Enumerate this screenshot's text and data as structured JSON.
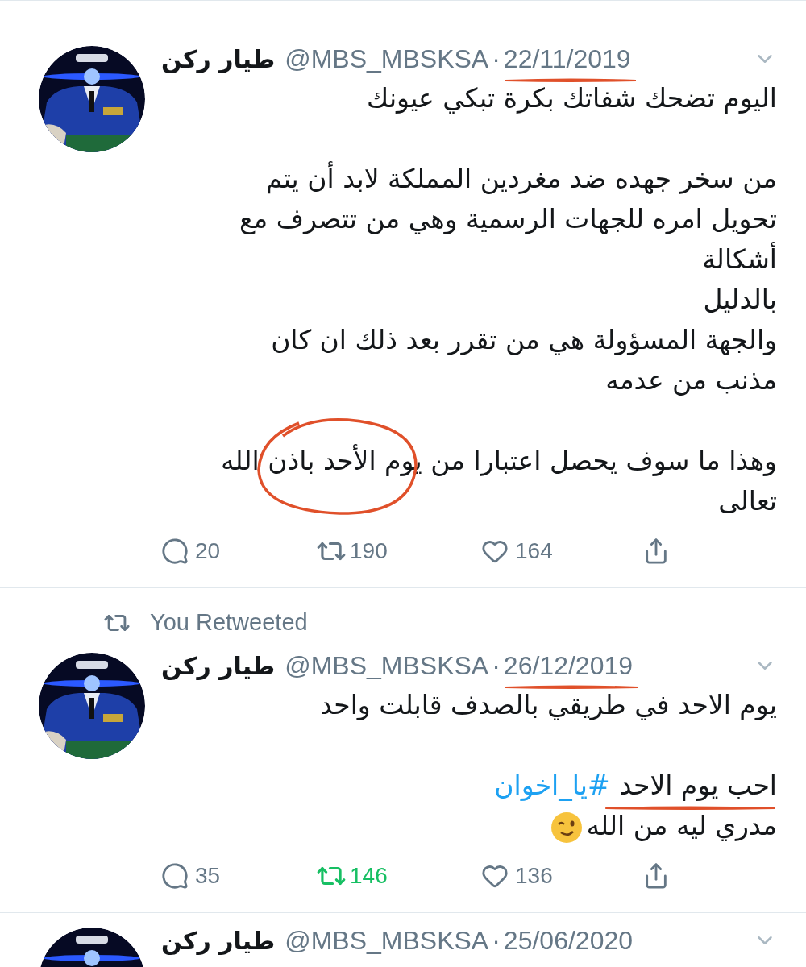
{
  "tweets": [
    {
      "name": "طيار ركن",
      "handle": "@MBS_MBSKSA",
      "dot": "·",
      "date": "22/11/2019",
      "date_marked": true,
      "paragraphs": [
        [
          {
            "text": "اليوم تضحك شفاتك بكرة تبكي عيونك"
          }
        ],
        [
          {
            "text": "من سخر جهده ضد مغردين المملكة لابد أن يتم"
          },
          {
            "text": "تحويل امره للجهات الرسمية وهي من تتصرف مع"
          },
          {
            "text": "أشكالة"
          },
          {
            "text": "بالدليل"
          },
          {
            "text": "والجهة المسؤولة هي من تقرر بعد ذلك ان كان"
          },
          {
            "text": "مذنب من عدمه"
          }
        ],
        [
          {
            "text": "وهذا ما سوف يحصل اعتبارا من يوم الأحد باذن الله",
            "circled": true
          },
          {
            "text": "تعالى"
          }
        ]
      ],
      "replies": "20",
      "retweets": "190",
      "likes": "164",
      "retweeted": false
    },
    {
      "retweet_label": "You Retweeted",
      "name": "طيار ركن",
      "handle": "@MBS_MBSKSA",
      "dot": "·",
      "date": "26/12/2019",
      "date_marked": true,
      "paragraphs": [
        [
          {
            "text": "يوم الاحد في طريقي بالصدف قابلت واحد"
          }
        ],
        [
          {
            "text": "احب يوم الاحد",
            "hashtag": "#يا_اخوان",
            "underlined": true
          },
          {
            "text": "مدري ليه من الله",
            "emoji": true
          }
        ]
      ],
      "replies": "35",
      "retweets": "146",
      "likes": "136",
      "retweeted": true
    },
    {
      "name": "طيار ركن",
      "handle": "@MBS_MBSKSA",
      "dot": "·",
      "date": "25/06/2020",
      "date_marked": false
    }
  ]
}
